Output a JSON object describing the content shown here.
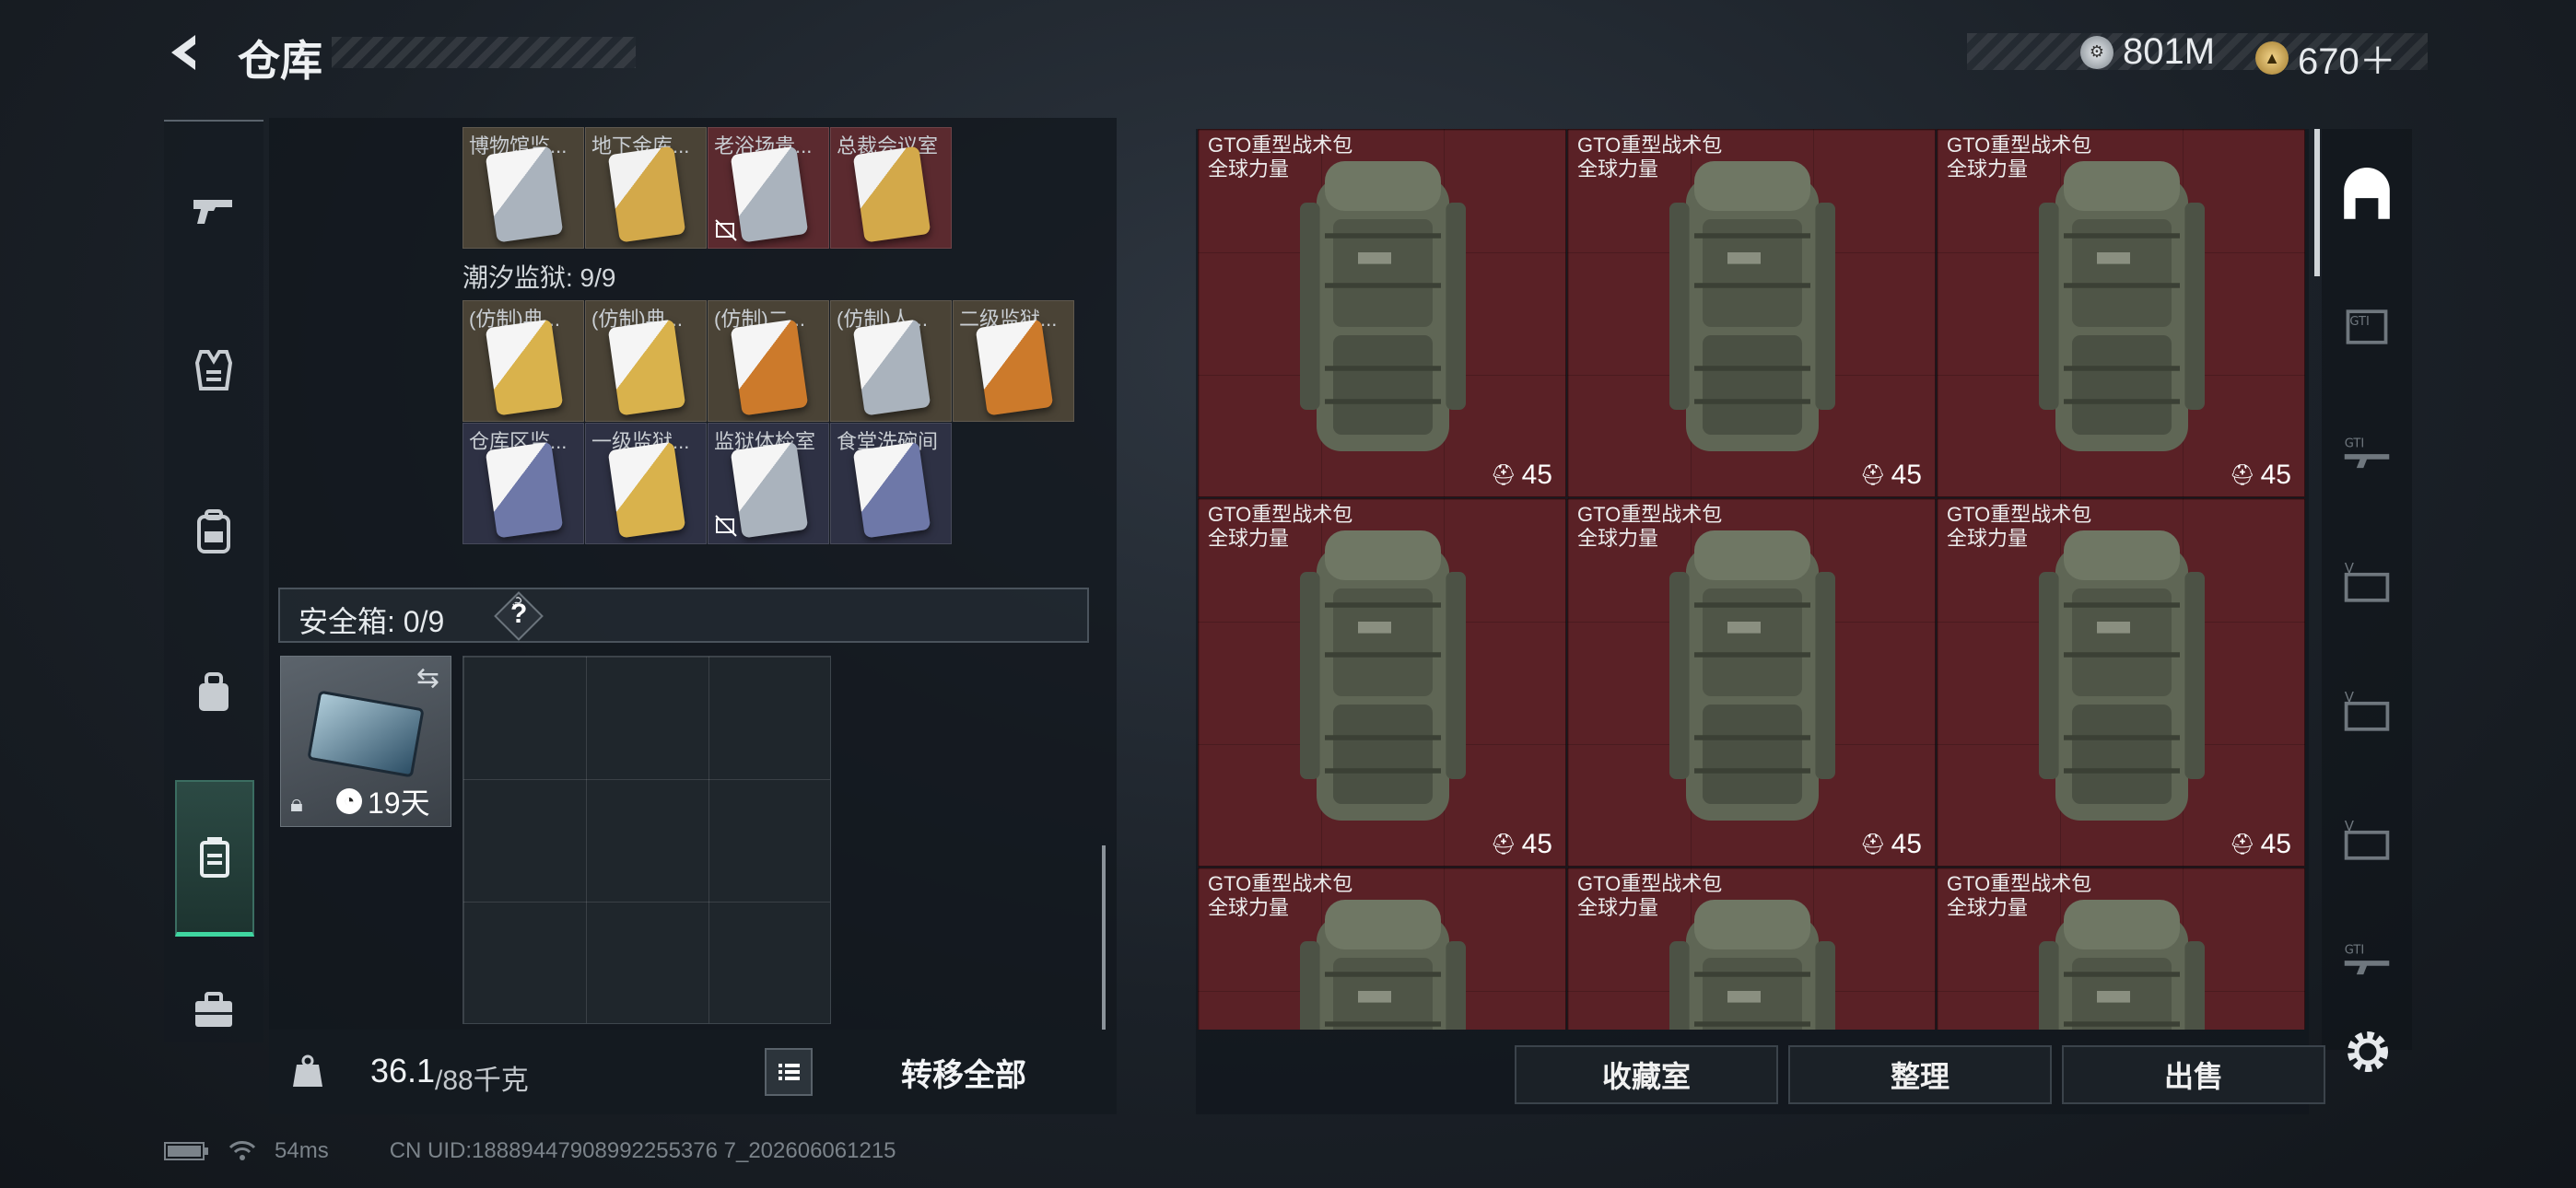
{
  "header": {
    "title": "仓库",
    "currency_silver": "801M",
    "currency_gold": "670＋"
  },
  "top_rows": {
    "row1_labels": [
      "博物馆监...",
      "地下金库...",
      "老浴场贵...",
      "总裁会议室"
    ],
    "section2_title": "潮汐监狱: 9/9",
    "row2_labels": [
      "(仿制)典...",
      "(仿制)典...",
      "(仿制)二...",
      "(仿制)人...",
      "二级监狱..."
    ],
    "row3_labels": [
      "仓库区监...",
      "一级监狱...",
      "监狱体检室",
      "食堂洗碗间"
    ]
  },
  "safebox": {
    "label": "安全箱: 0/9",
    "help": "?",
    "duration": "19天"
  },
  "weight": {
    "current": "36.1",
    "max": "/88千克",
    "transfer_all": "转移全部"
  },
  "bags": {
    "name": "GTO重型战术包",
    "sub": "全球力量",
    "count": "45"
  },
  "buttons": {
    "collection": "收藏室",
    "sort": "整理",
    "sell": "出售"
  },
  "status": {
    "ping": "54ms",
    "uid": "CN UID:18889447908992255376 7_202606061215"
  }
}
